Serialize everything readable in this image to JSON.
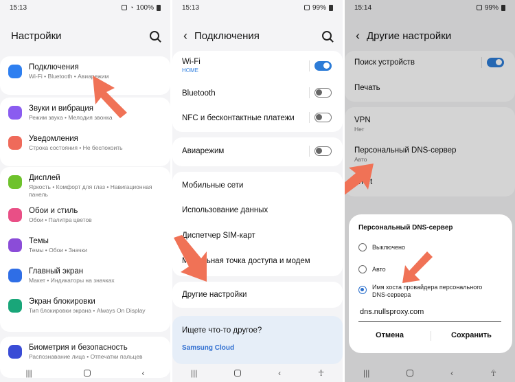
{
  "panel1": {
    "status": {
      "time": "15:13",
      "battery": "100%"
    },
    "title": "Настройки",
    "groups": [
      [
        {
          "label": "Подключения",
          "sub": "Wi-Fi  •  Bluetooth  •  Авиарежим",
          "icon": "wifi-icon",
          "color": "#2e7ff0"
        }
      ],
      [
        {
          "label": "Звуки и вибрация",
          "sub": "Режим звука  •  Мелодия звонка",
          "icon": "volume-icon",
          "color": "#8a5cf0"
        },
        {
          "label": "Уведомления",
          "sub": "Строка состояния  •  Не беспокоить",
          "icon": "notification-icon",
          "color": "#ef6a5a"
        }
      ],
      [
        {
          "label": "Дисплей",
          "sub": "Яркость  •  Комфорт для глаз  •  Навигационная панель",
          "icon": "brightness-icon",
          "color": "#6ec22c"
        },
        {
          "label": "Обои и стиль",
          "sub": "Обои  •  Палитра цветов",
          "icon": "palette-icon",
          "color": "#e94f86"
        },
        {
          "label": "Темы",
          "sub": "Темы  •  Обои  •  Значки",
          "icon": "themes-icon",
          "color": "#8b4cd8"
        },
        {
          "label": "Главный экран",
          "sub": "Макет  •  Индикаторы на значках",
          "icon": "home-icon",
          "color": "#2f6ee6"
        },
        {
          "label": "Экран блокировки",
          "sub": "Тип блокировки экрана  •  Always On Display",
          "icon": "lock-icon",
          "color": "#19a679"
        }
      ],
      [
        {
          "label": "Биометрия и безопасность",
          "sub": "Распознавание лица  •  Отпечатки пальцев",
          "icon": "shield-icon",
          "color": "#3a4cd6"
        }
      ]
    ]
  },
  "panel2": {
    "status": {
      "time": "15:13",
      "battery": "99%"
    },
    "title": "Подключения",
    "wifi": {
      "label": "Wi-Fi",
      "sub": "HOME"
    },
    "bluetooth": "Bluetooth",
    "nfc": "NFC и бесконтактные платежи",
    "airplane": "Авиарежим",
    "mobile": "Мобильные сети",
    "data_usage": "Использование данных",
    "sim": "Диспетчер SIM-карт",
    "hotspot": "Мобильная точка доступа и модем",
    "more": "Другие настройки",
    "looking": "Ищете что-то другое?",
    "cloud": "Samsung Cloud"
  },
  "panel3": {
    "status": {
      "time": "15:14",
      "battery": "99%"
    },
    "title": "Другие настройки",
    "nearby": "Поиск устройств",
    "print": "Печать",
    "vpn": {
      "label": "VPN",
      "sub": "Нет"
    },
    "dns": {
      "label": "Персональный DNS-сервер",
      "sub": "Авто"
    },
    "ethernet": "ernet",
    "dialog": {
      "title": "Персональный DNS-сервер",
      "opt_off": "Выключено",
      "opt_auto": "Авто",
      "opt_host": "Имя хоста провайдера персонального DNS-сервера",
      "hostname": "dns.nullsproxy.com",
      "cancel": "Отмена",
      "save": "Сохранить"
    }
  },
  "colors": {
    "accent": "#2d7cd7",
    "arrow": "#f07256"
  }
}
